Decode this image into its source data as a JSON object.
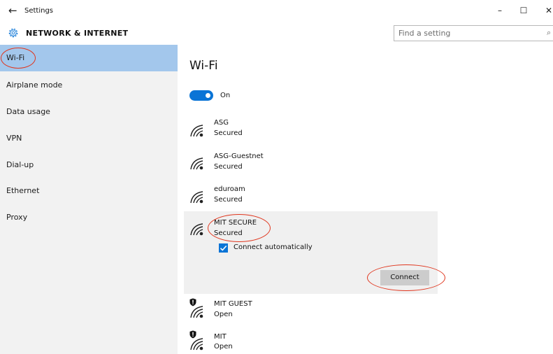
{
  "window": {
    "title": "Settings",
    "back_icon": "←",
    "minimize_icon": "–",
    "maximize_icon": "☐",
    "close_icon": "✕"
  },
  "header": {
    "section_title": "NETWORK & INTERNET",
    "search_placeholder": "Find a setting",
    "search_icon": "⌕"
  },
  "sidebar": {
    "items": [
      {
        "label": "Wi-Fi",
        "active": true
      },
      {
        "label": "Airplane mode"
      },
      {
        "label": "Data usage"
      },
      {
        "label": "VPN"
      },
      {
        "label": "Dial-up"
      },
      {
        "label": "Ethernet"
      },
      {
        "label": "Proxy"
      }
    ]
  },
  "main": {
    "heading": "Wi-Fi",
    "toggle_label": "On",
    "networks": [
      {
        "name": "ASG",
        "status": "Secured"
      },
      {
        "name": "ASG-Guestnet",
        "status": "Secured"
      },
      {
        "name": "eduroam",
        "status": "Secured"
      },
      {
        "name": "MIT SECURE",
        "status": "Secured",
        "connect_auto_label": "Connect automatically",
        "connect_label": "Connect"
      },
      {
        "name": "MIT GUEST",
        "status": "Open"
      },
      {
        "name": "MIT",
        "status": "Open"
      }
    ]
  },
  "colors": {
    "accent": "#0a74d6",
    "sidebar_active": "#a3c7ec",
    "annotation": "#e0371f"
  }
}
